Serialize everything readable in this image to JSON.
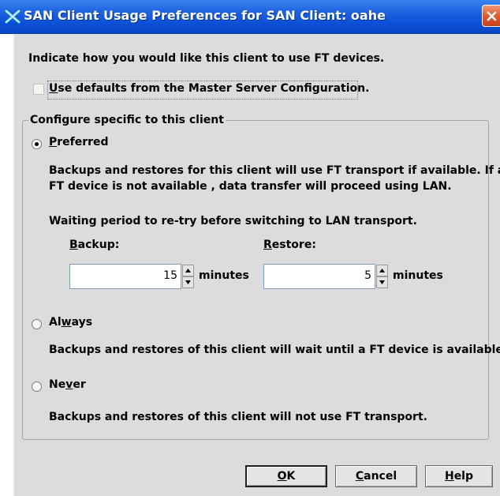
{
  "window": {
    "title": "SAN Client Usage Preferences for SAN Client: oahe"
  },
  "intro_text": "Indicate how you would like this client to use FT devices.",
  "use_defaults": {
    "label_mnemonic": "U",
    "label_rest": "se defaults from the Master Server Configuration.",
    "checked": false
  },
  "config_group": {
    "title": "Configure specific to this client",
    "preferred": {
      "label_mnemonic": "P",
      "label_rest": "referred",
      "selected": true,
      "description_line1": "Backups and restores for this client will use FT transport if available. If a",
      "description_line2": "FT device is not available , data transfer will proceed using LAN.",
      "waiting_text": "Waiting period to re-try before switching to LAN transport.",
      "backup_label_mnemonic": "B",
      "backup_label_rest": "ackup:",
      "backup_value": "15",
      "backup_unit": "minutes",
      "restore_label_mnemonic": "R",
      "restore_label_rest": "estore:",
      "restore_value": "5",
      "restore_unit": "minutes"
    },
    "always": {
      "label_before": "Al",
      "label_mnemonic": "w",
      "label_rest": "ays",
      "selected": false,
      "description": "Backups and restores of this client will wait until a FT device is available."
    },
    "never": {
      "label_before": "Ne",
      "label_mnemonic": "v",
      "label_rest": "er",
      "selected": false,
      "description": "Backups and restores of this client will not use FT transport."
    }
  },
  "buttons": {
    "ok_mnemonic": "O",
    "ok_rest": "K",
    "cancel_mnemonic": "C",
    "cancel_rest": "ancel",
    "help_mnemonic": "H",
    "help_rest": "elp"
  },
  "colors": {
    "titlebar": "#0c50d6",
    "close_button": "#e25a2f",
    "dialog_background": "#dcdcdc"
  },
  "icons": {
    "app": "x-cross-icon",
    "close": "close-icon",
    "spin_up": "arrow-up-icon",
    "spin_down": "arrow-down-icon"
  }
}
